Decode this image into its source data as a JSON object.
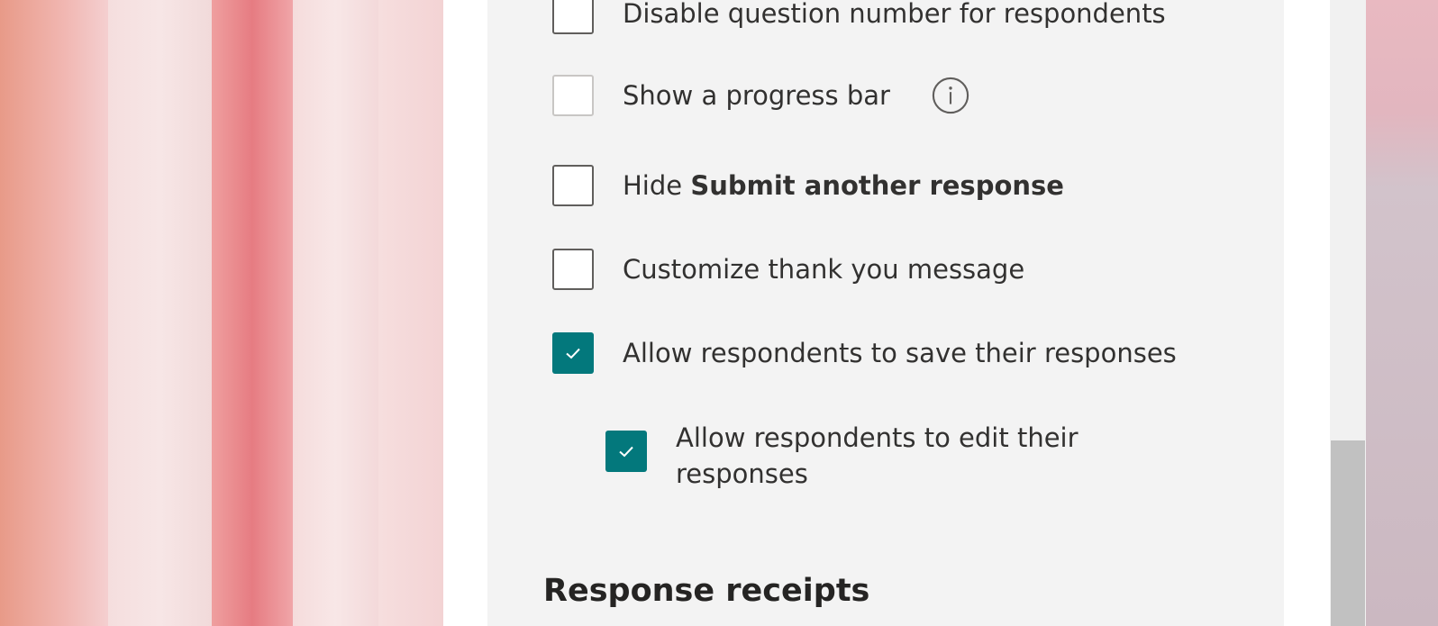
{
  "settings": {
    "options": [
      {
        "label": "Disable question number for respondents",
        "checked": false
      },
      {
        "label": "Show a progress bar",
        "checked": false,
        "disabled": true,
        "info_icon": "info-icon"
      },
      {
        "label_prefix": "Hide ",
        "label_bold": "Submit another response",
        "checked": false
      },
      {
        "label": "Customize thank you message",
        "checked": false
      },
      {
        "label": "Allow respondents to save their responses",
        "checked": true
      },
      {
        "label": "Allow respondents to edit their responses",
        "checked": true,
        "nested": true
      }
    ],
    "section_title": "Response receipts"
  },
  "colors": {
    "checkbox_checked": "#03787c",
    "card_background": "#f3f3f3",
    "text": "#323130"
  },
  "icons": [
    "checkmark-icon",
    "info-icon"
  ]
}
